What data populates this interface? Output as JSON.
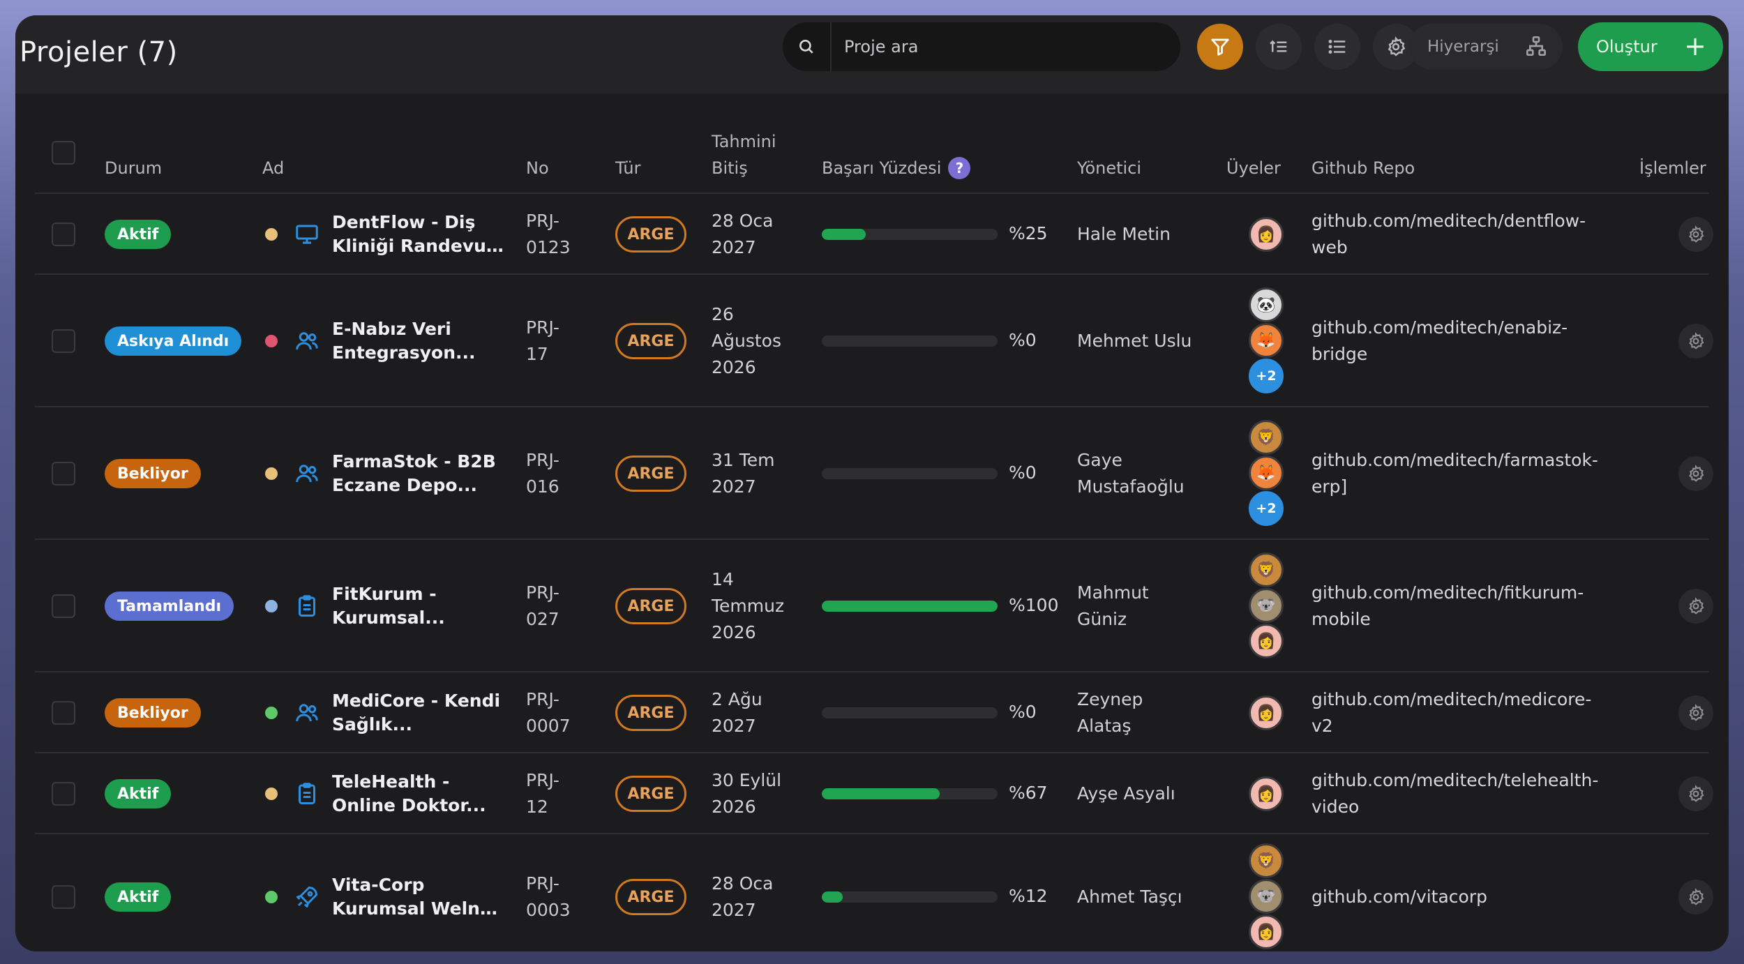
{
  "header": {
    "title": "Projeler (7)",
    "search_placeholder": "Proje ara",
    "hierarchy_label": "Hiyerarşi",
    "create_label": "Oluştur",
    "create_icon": "+"
  },
  "columns": {
    "status": "Durum",
    "name": "Ad",
    "no": "No",
    "type": "Tür",
    "due_line1": "Tahmini",
    "due_line2": "Bitiş",
    "success": "Başarı Yüzdesi",
    "success_help": "?",
    "manager": "Yönetici",
    "members": "Üyeler",
    "repo": "Github Repo",
    "actions": "İşlemler"
  },
  "colors": {
    "accent_orange": "#c77a14",
    "create_green": "#1f9d4f",
    "progress_green": "#22a553",
    "status_active": "#1f9d4f",
    "status_suspended": "#1f8fd6",
    "status_waiting": "#c7650e",
    "status_done": "#5b6fd0",
    "type_orange": "#d27a22"
  },
  "rows": [
    {
      "status": "Aktif",
      "status_color": "#1f9d4f",
      "dot_color": "#e8c07a",
      "icon": "monitor-icon",
      "name_l1": "DentFlow - Diş",
      "name_l2": "Kliniği Randevu v...",
      "no_l1": "PRJ-",
      "no_l2": "0123",
      "type": "ARGE",
      "date_l1": "28 Oca",
      "date_l2": "2027",
      "date_l3": "",
      "progress": 25,
      "pct": "%25",
      "mgr_l1": "Hale Metin",
      "mgr_l2": "",
      "members": [
        {
          "e": "👩",
          "bg": "#f1b9b0"
        }
      ],
      "repo_l1": "github.com/meditech/dentflow-",
      "repo_l2": "web"
    },
    {
      "status": "Askıya Alındı",
      "status_color": "#1f8fd6",
      "dot_color": "#e0566e",
      "icon": "users-icon",
      "name_l1": "E-Nabız Veri",
      "name_l2": "Entegrasyon...",
      "no_l1": "PRJ-",
      "no_l2": "17",
      "type": "ARGE",
      "date_l1": "26",
      "date_l2": "Ağustos",
      "date_l3": "2026",
      "progress": 0,
      "pct": "%0",
      "mgr_l1": "Mehmet Uslu",
      "mgr_l2": "",
      "members": [
        {
          "e": "🐼",
          "bg": "#d9d9d9"
        },
        {
          "e": "🦊",
          "bg": "#f0843c"
        },
        {
          "e": "+2",
          "bg": "#2d8fe0",
          "plus": true
        }
      ],
      "repo_l1": "github.com/meditech/enabiz-",
      "repo_l2": "bridge"
    },
    {
      "status": "Bekliyor",
      "status_color": "#c7650e",
      "dot_color": "#e8c07a",
      "icon": "users-icon",
      "name_l1": "FarmaStok - B2B",
      "name_l2": "Eczane Depo...",
      "no_l1": "PRJ-",
      "no_l2": "016",
      "type": "ARGE",
      "date_l1": "31 Tem",
      "date_l2": "2027",
      "date_l3": "",
      "progress": 0,
      "pct": "%0",
      "mgr_l1": "Gaye",
      "mgr_l2": "Mustafaoğlu",
      "members": [
        {
          "e": "🦁",
          "bg": "#c98a3e"
        },
        {
          "e": "🦊",
          "bg": "#f0843c"
        },
        {
          "e": "+2",
          "bg": "#2d8fe0",
          "plus": true
        }
      ],
      "repo_l1": "github.com/meditech/farmastok-",
      "repo_l2": "erp]"
    },
    {
      "status": "Tamamlandı",
      "status_color": "#5b6fd0",
      "dot_color": "#8fb3e0",
      "icon": "clipboard-icon",
      "name_l1": "FitKurum -",
      "name_l2": "Kurumsal...",
      "no_l1": "PRJ-",
      "no_l2": "027",
      "type": "ARGE",
      "date_l1": "14",
      "date_l2": "Temmuz",
      "date_l3": "2026",
      "progress": 100,
      "pct": "%100",
      "mgr_l1": "Mahmut",
      "mgr_l2": "Güniz",
      "members": [
        {
          "e": "🦁",
          "bg": "#c98a3e"
        },
        {
          "e": "🐨",
          "bg": "#a08e6e"
        },
        {
          "e": "👩",
          "bg": "#f1b9b0"
        }
      ],
      "repo_l1": "github.com/meditech/fitkurum-",
      "repo_l2": "mobile"
    },
    {
      "status": "Bekliyor",
      "status_color": "#c7650e",
      "dot_color": "#5ec86a",
      "icon": "users-icon",
      "name_l1": "MediCore - Kendi",
      "name_l2": "Sağlık...",
      "no_l1": "PRJ-",
      "no_l2": "0007",
      "type": "ARGE",
      "date_l1": "2 Ağu",
      "date_l2": "2027",
      "date_l3": "",
      "progress": 0,
      "pct": "%0",
      "mgr_l1": "Zeynep",
      "mgr_l2": "Alataş",
      "members": [
        {
          "e": "👩",
          "bg": "#f1b9b0"
        }
      ],
      "repo_l1": "github.com/meditech/medicore-",
      "repo_l2": "v2"
    },
    {
      "status": "Aktif",
      "status_color": "#1f9d4f",
      "dot_color": "#e8c07a",
      "icon": "clipboard-icon",
      "name_l1": "TeleHealth -",
      "name_l2": "Online Doktor...",
      "no_l1": "PRJ-",
      "no_l2": "12",
      "type": "ARGE",
      "date_l1": "30 Eylül",
      "date_l2": "2026",
      "date_l3": "",
      "progress": 67,
      "pct": "%67",
      "mgr_l1": "Ayşe Asyalı",
      "mgr_l2": "",
      "members": [
        {
          "e": "👩",
          "bg": "#f1b9b0"
        }
      ],
      "repo_l1": "github.com/meditech/telehealth-",
      "repo_l2": "video"
    },
    {
      "status": "Aktif",
      "status_color": "#1f9d4f",
      "dot_color": "#5ec86a",
      "icon": "rocket-icon",
      "name_l1": "Vita-Corp",
      "name_l2": "Kurumsal Welne...",
      "no_l1": "PRJ-",
      "no_l2": "0003",
      "type": "ARGE",
      "date_l1": "28 Oca",
      "date_l2": "2027",
      "date_l3": "",
      "progress": 12,
      "pct": "%12",
      "mgr_l1": "Ahmet Taşçı",
      "mgr_l2": "",
      "members": [
        {
          "e": "🦁",
          "bg": "#c98a3e"
        },
        {
          "e": "🐨",
          "bg": "#a08e6e"
        },
        {
          "e": "👩",
          "bg": "#f1b9b0"
        }
      ],
      "repo_l1": "github.com/vitacorp",
      "repo_l2": ""
    }
  ]
}
